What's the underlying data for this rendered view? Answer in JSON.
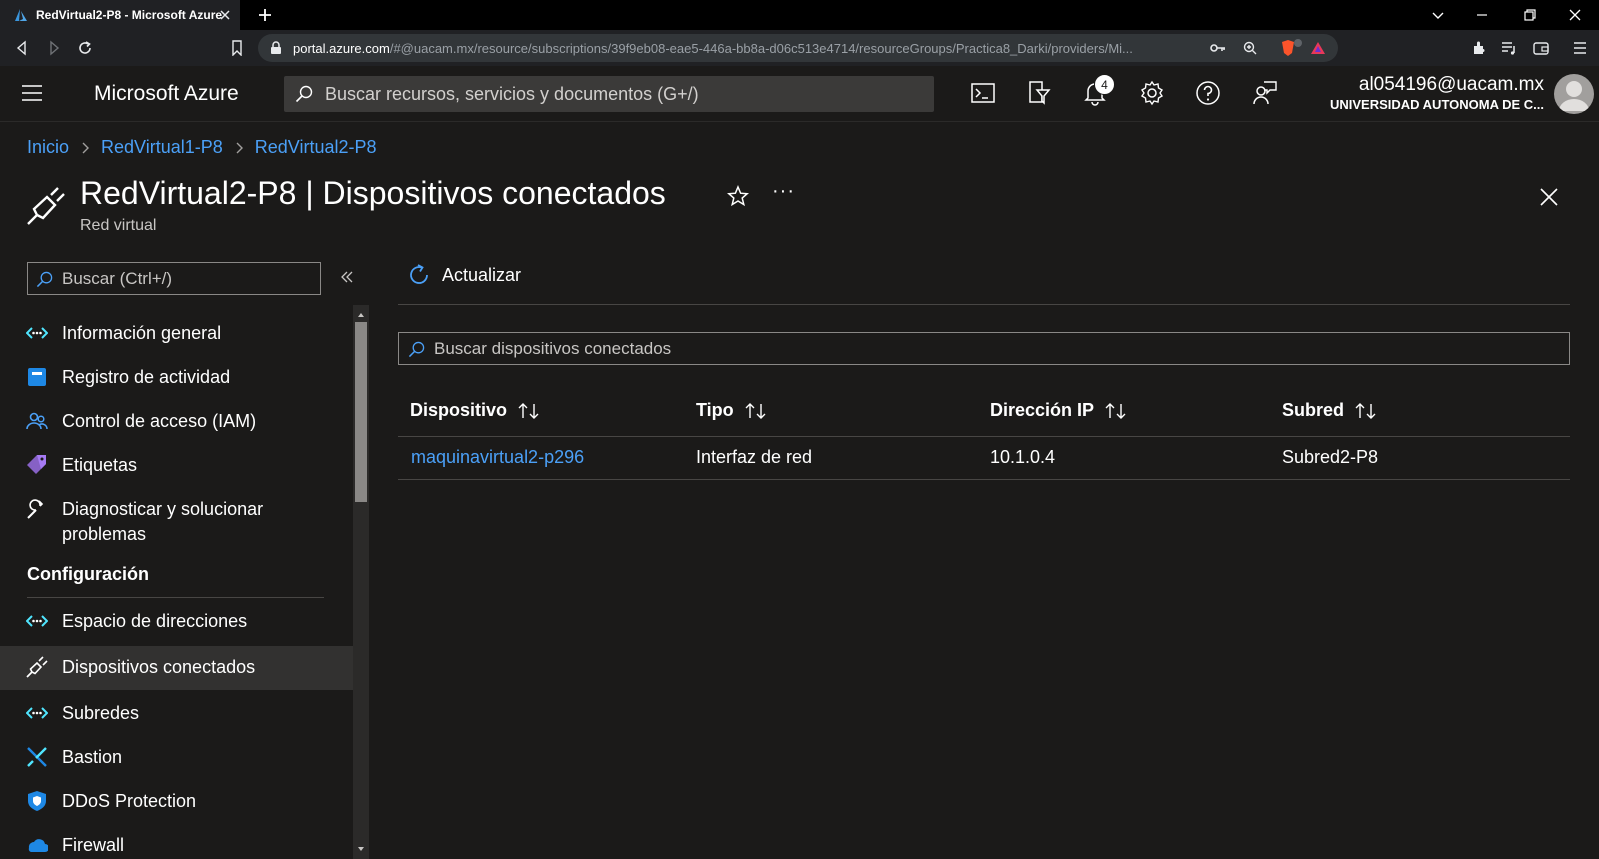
{
  "browser": {
    "tab_title": "RedVirtual2-P8 - Microsoft Azure",
    "url_host": "portal.azure.com",
    "url_path": "/#@uacam.mx/resource/subscriptions/39f9eb08-eae5-446a-bb8a-d06c513e4714/resourceGroups/Practica8_Darki/providers/Mi..."
  },
  "header": {
    "brand": "Microsoft Azure",
    "search_placeholder": "Buscar recursos, servicios y documentos (G+/)",
    "notification_count": "4",
    "user_email": "al054196@uacam.mx",
    "user_org": "UNIVERSIDAD AUTONOMA DE C..."
  },
  "breadcrumb": {
    "items": [
      "Inicio",
      "RedVirtual1-P8",
      "RedVirtual2-P8"
    ]
  },
  "page": {
    "title": "RedVirtual2-P8 | Dispositivos conectados",
    "subtitle": "Red virtual"
  },
  "sidebar": {
    "search_placeholder": "Buscar (Ctrl+/)",
    "items": [
      {
        "label": "Información general",
        "icon": "vnet-overview-icon"
      },
      {
        "label": "Registro de actividad",
        "icon": "activity-log-icon"
      },
      {
        "label": "Control de acceso (IAM)",
        "icon": "iam-icon"
      },
      {
        "label": "Etiquetas",
        "icon": "tag-icon"
      },
      {
        "label": "Diagnosticar y solucionar problemas",
        "icon": "wrench-icon"
      }
    ],
    "group_label": "Configuración",
    "config_items": [
      {
        "label": "Espacio de direcciones",
        "icon": "address-space-icon"
      },
      {
        "label": "Dispositivos conectados",
        "icon": "plug-icon",
        "active": true
      },
      {
        "label": "Subredes",
        "icon": "subnet-icon"
      },
      {
        "label": "Bastion",
        "icon": "bastion-icon"
      },
      {
        "label": "DDoS Protection",
        "icon": "shield-icon"
      },
      {
        "label": "Firewall",
        "icon": "firewall-icon"
      }
    ]
  },
  "main": {
    "refresh_label": "Actualizar",
    "filter_placeholder": "Buscar dispositivos conectados",
    "columns": [
      "Dispositivo",
      "Tipo",
      "Dirección IP",
      "Subred"
    ],
    "rows": [
      {
        "device": "maquinavirtual2-p296",
        "type": "Interfaz de red",
        "ip": "10.1.0.4",
        "subnet": "Subred2-P8"
      }
    ]
  },
  "colors": {
    "accent": "#4ba0f7",
    "background": "#1b1a19",
    "active_nav": "#323130"
  }
}
